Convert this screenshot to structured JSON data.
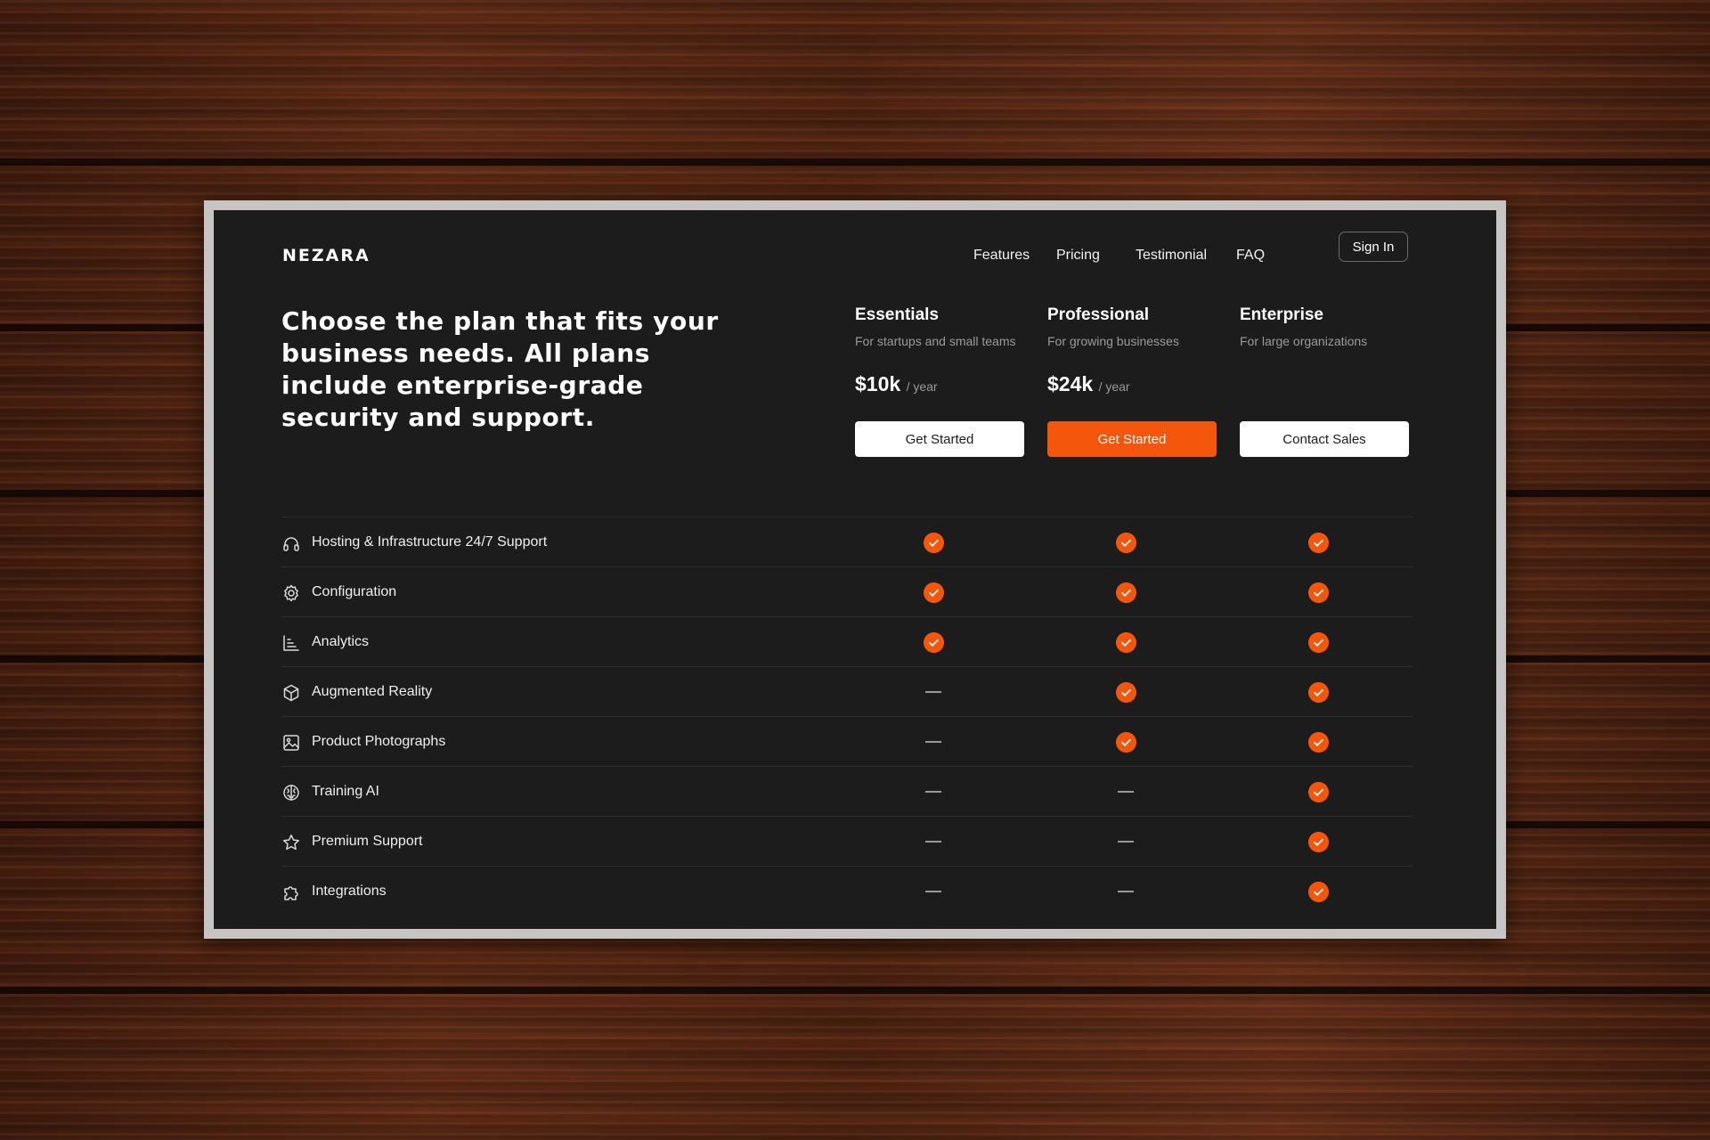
{
  "brand": {
    "logo": "NEZARA"
  },
  "nav": {
    "features": "Features",
    "pricing": "Pricing",
    "testimonial": "Testimonial",
    "faq": "FAQ",
    "sign_in": "Sign In"
  },
  "hero": {
    "headline": "Choose the plan that fits your business needs. All plans include enterprise-grade security and support."
  },
  "plans": [
    {
      "name": "Essentials",
      "description": "For startups and small teams",
      "price": "$10k",
      "period": "/ year",
      "cta": "Get Started"
    },
    {
      "name": "Professional",
      "description": "For growing businesses",
      "price": "$24k",
      "period": "/ year",
      "cta": "Get Started"
    },
    {
      "name": "Enterprise",
      "description": "For large organizations",
      "price": "",
      "period": "",
      "cta": "Contact Sales"
    }
  ],
  "features": [
    {
      "label": "Hosting & Infrastructure 24/7 Support",
      "icon": "headphones-icon",
      "included": [
        true,
        true,
        true
      ]
    },
    {
      "label": "Configuration",
      "icon": "gear-icon",
      "included": [
        true,
        true,
        true
      ]
    },
    {
      "label": "Analytics",
      "icon": "chart-icon",
      "included": [
        true,
        true,
        true
      ]
    },
    {
      "label": "Augmented Reality",
      "icon": "cube-icon",
      "included": [
        false,
        true,
        true
      ]
    },
    {
      "label": "Product Photographs",
      "icon": "image-icon",
      "included": [
        false,
        true,
        true
      ]
    },
    {
      "label": "Training AI",
      "icon": "brain-icon",
      "included": [
        false,
        false,
        true
      ]
    },
    {
      "label": "Premium Support",
      "icon": "star-icon",
      "included": [
        false,
        false,
        true
      ]
    },
    {
      "label": "Integrations",
      "icon": "puzzle-icon",
      "included": [
        false,
        false,
        true
      ]
    }
  ],
  "colors": {
    "accent": "#f4560b",
    "background": "#1c1c1d",
    "muted_text": "#9a9a9a"
  }
}
